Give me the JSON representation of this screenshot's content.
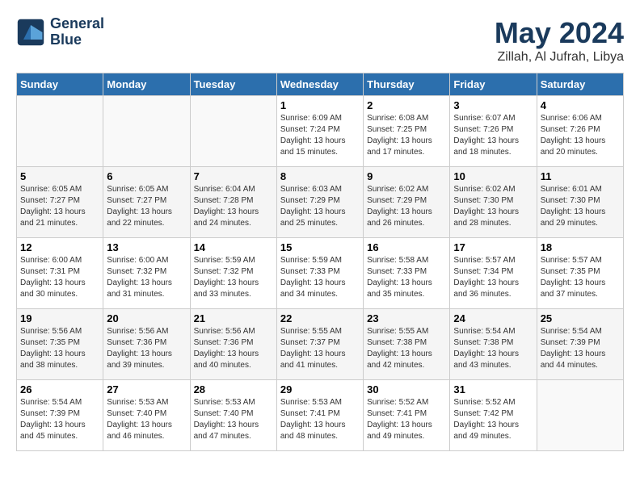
{
  "header": {
    "logo_line1": "General",
    "logo_line2": "Blue",
    "title": "May 2024",
    "subtitle": "Zillah, Al Jufrah, Libya"
  },
  "days_of_week": [
    "Sunday",
    "Monday",
    "Tuesday",
    "Wednesday",
    "Thursday",
    "Friday",
    "Saturday"
  ],
  "weeks": [
    [
      {
        "day": "",
        "info": ""
      },
      {
        "day": "",
        "info": ""
      },
      {
        "day": "",
        "info": ""
      },
      {
        "day": "1",
        "info": "Sunrise: 6:09 AM\nSunset: 7:24 PM\nDaylight: 13 hours\nand 15 minutes."
      },
      {
        "day": "2",
        "info": "Sunrise: 6:08 AM\nSunset: 7:25 PM\nDaylight: 13 hours\nand 17 minutes."
      },
      {
        "day": "3",
        "info": "Sunrise: 6:07 AM\nSunset: 7:26 PM\nDaylight: 13 hours\nand 18 minutes."
      },
      {
        "day": "4",
        "info": "Sunrise: 6:06 AM\nSunset: 7:26 PM\nDaylight: 13 hours\nand 20 minutes."
      }
    ],
    [
      {
        "day": "5",
        "info": "Sunrise: 6:05 AM\nSunset: 7:27 PM\nDaylight: 13 hours\nand 21 minutes."
      },
      {
        "day": "6",
        "info": "Sunrise: 6:05 AM\nSunset: 7:27 PM\nDaylight: 13 hours\nand 22 minutes."
      },
      {
        "day": "7",
        "info": "Sunrise: 6:04 AM\nSunset: 7:28 PM\nDaylight: 13 hours\nand 24 minutes."
      },
      {
        "day": "8",
        "info": "Sunrise: 6:03 AM\nSunset: 7:29 PM\nDaylight: 13 hours\nand 25 minutes."
      },
      {
        "day": "9",
        "info": "Sunrise: 6:02 AM\nSunset: 7:29 PM\nDaylight: 13 hours\nand 26 minutes."
      },
      {
        "day": "10",
        "info": "Sunrise: 6:02 AM\nSunset: 7:30 PM\nDaylight: 13 hours\nand 28 minutes."
      },
      {
        "day": "11",
        "info": "Sunrise: 6:01 AM\nSunset: 7:30 PM\nDaylight: 13 hours\nand 29 minutes."
      }
    ],
    [
      {
        "day": "12",
        "info": "Sunrise: 6:00 AM\nSunset: 7:31 PM\nDaylight: 13 hours\nand 30 minutes."
      },
      {
        "day": "13",
        "info": "Sunrise: 6:00 AM\nSunset: 7:32 PM\nDaylight: 13 hours\nand 31 minutes."
      },
      {
        "day": "14",
        "info": "Sunrise: 5:59 AM\nSunset: 7:32 PM\nDaylight: 13 hours\nand 33 minutes."
      },
      {
        "day": "15",
        "info": "Sunrise: 5:59 AM\nSunset: 7:33 PM\nDaylight: 13 hours\nand 34 minutes."
      },
      {
        "day": "16",
        "info": "Sunrise: 5:58 AM\nSunset: 7:33 PM\nDaylight: 13 hours\nand 35 minutes."
      },
      {
        "day": "17",
        "info": "Sunrise: 5:57 AM\nSunset: 7:34 PM\nDaylight: 13 hours\nand 36 minutes."
      },
      {
        "day": "18",
        "info": "Sunrise: 5:57 AM\nSunset: 7:35 PM\nDaylight: 13 hours\nand 37 minutes."
      }
    ],
    [
      {
        "day": "19",
        "info": "Sunrise: 5:56 AM\nSunset: 7:35 PM\nDaylight: 13 hours\nand 38 minutes."
      },
      {
        "day": "20",
        "info": "Sunrise: 5:56 AM\nSunset: 7:36 PM\nDaylight: 13 hours\nand 39 minutes."
      },
      {
        "day": "21",
        "info": "Sunrise: 5:56 AM\nSunset: 7:36 PM\nDaylight: 13 hours\nand 40 minutes."
      },
      {
        "day": "22",
        "info": "Sunrise: 5:55 AM\nSunset: 7:37 PM\nDaylight: 13 hours\nand 41 minutes."
      },
      {
        "day": "23",
        "info": "Sunrise: 5:55 AM\nSunset: 7:38 PM\nDaylight: 13 hours\nand 42 minutes."
      },
      {
        "day": "24",
        "info": "Sunrise: 5:54 AM\nSunset: 7:38 PM\nDaylight: 13 hours\nand 43 minutes."
      },
      {
        "day": "25",
        "info": "Sunrise: 5:54 AM\nSunset: 7:39 PM\nDaylight: 13 hours\nand 44 minutes."
      }
    ],
    [
      {
        "day": "26",
        "info": "Sunrise: 5:54 AM\nSunset: 7:39 PM\nDaylight: 13 hours\nand 45 minutes."
      },
      {
        "day": "27",
        "info": "Sunrise: 5:53 AM\nSunset: 7:40 PM\nDaylight: 13 hours\nand 46 minutes."
      },
      {
        "day": "28",
        "info": "Sunrise: 5:53 AM\nSunset: 7:40 PM\nDaylight: 13 hours\nand 47 minutes."
      },
      {
        "day": "29",
        "info": "Sunrise: 5:53 AM\nSunset: 7:41 PM\nDaylight: 13 hours\nand 48 minutes."
      },
      {
        "day": "30",
        "info": "Sunrise: 5:52 AM\nSunset: 7:41 PM\nDaylight: 13 hours\nand 49 minutes."
      },
      {
        "day": "31",
        "info": "Sunrise: 5:52 AM\nSunset: 7:42 PM\nDaylight: 13 hours\nand 49 minutes."
      },
      {
        "day": "",
        "info": ""
      }
    ]
  ]
}
